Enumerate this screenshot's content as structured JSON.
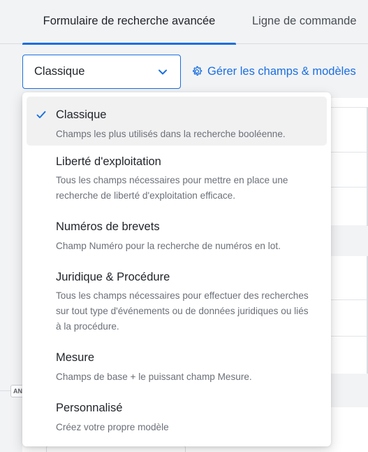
{
  "tabs": [
    {
      "label": "Formulaire de recherche avancée",
      "active": true
    },
    {
      "label": "Ligne de commande",
      "active": false
    }
  ],
  "template_select": {
    "value": "Classique",
    "icon": "chevron-down-icon"
  },
  "manage_link": {
    "label": "Gérer les champs & modèles",
    "icon": "gear-icon"
  },
  "background": {
    "operator_chip": "AN"
  },
  "menu": {
    "options": [
      {
        "title": "Classique",
        "description": "Champs les plus utilisés dans la recherche booléenne.",
        "selected": true
      },
      {
        "title": "Liberté d'exploitation",
        "description": "Tous les champs nécessaires pour mettre en place une recherche de liberté d'exploitation efficace.",
        "selected": false
      },
      {
        "title": "Numéros de brevets",
        "description": "Champ Numéro pour la recherche de numéros en lot.",
        "selected": false
      },
      {
        "title": "Juridique & Procédure",
        "description": "Tous les champs nécessaires pour effectuer des recherches sur tout type d'événements ou de données juridiques ou liés à la procédure.",
        "selected": false
      },
      {
        "title": "Mesure",
        "description": "Champs de base + le puissant champ Mesure.",
        "selected": false
      },
      {
        "title": "Personnalisé",
        "description": "Créez votre propre modèle",
        "selected": false
      }
    ]
  },
  "colors": {
    "accent": "#1a6fe0",
    "selected_bg": "#f1f1f2",
    "page_bg": "#f2f3f5"
  }
}
